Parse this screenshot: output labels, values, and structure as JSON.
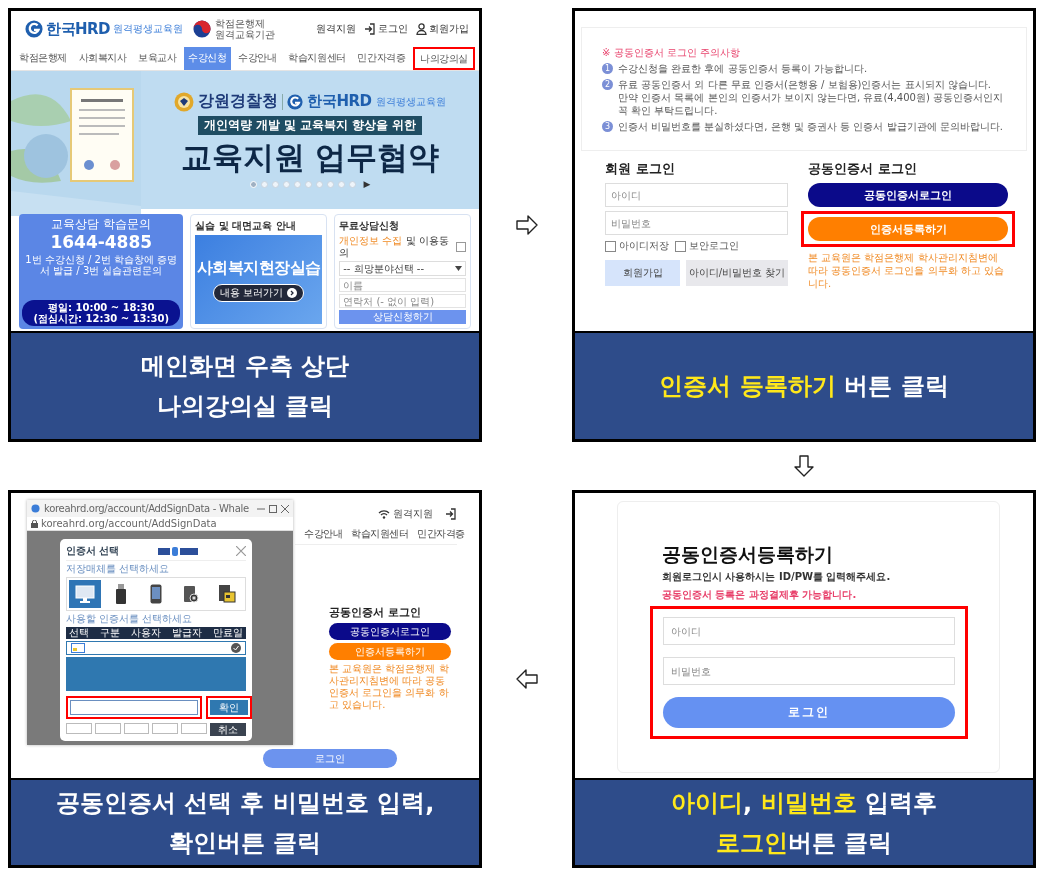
{
  "panels": [
    {
      "kind": "main_page",
      "header": {
        "logo": "한국HRD",
        "logo_sub": "원격평생교육원",
        "partner": "학점은행제 원격교육기관",
        "links": [
          {
            "kind": "remote",
            "label": "원격지원"
          },
          {
            "kind": "login",
            "label": "로그인"
          },
          {
            "kind": "join",
            "label": "회원가입"
          }
        ]
      },
      "nav": [
        {
          "label": "학점은행제",
          "selected": false,
          "highlighted": false
        },
        {
          "label": "사회복지사",
          "selected": false,
          "highlighted": false
        },
        {
          "label": "보육교사",
          "selected": false,
          "highlighted": false
        },
        {
          "label": "수강신청",
          "selected": true,
          "highlighted": false
        },
        {
          "label": "수강안내",
          "selected": false,
          "highlighted": false
        },
        {
          "label": "학습지원센터",
          "selected": false,
          "highlighted": false
        },
        {
          "label": "민간자격증",
          "selected": false,
          "highlighted": false
        },
        {
          "label": "나의강의실",
          "selected": false,
          "highlighted": true
        }
      ],
      "banner": {
        "org_left": "강원경찰청",
        "org_right": "한국HRD",
        "org_right_sub": "원격평생교육원",
        "subtitle": "개인역량 개발 및 교육복지 향상을 위한",
        "title": "교육지원 업무협약",
        "dots": [
          {
            "selected": true
          },
          {
            "selected": false
          },
          {
            "selected": false
          },
          {
            "selected": false
          },
          {
            "selected": false
          },
          {
            "selected": false
          },
          {
            "selected": false
          },
          {
            "selected": false
          },
          {
            "selected": false
          },
          {
            "selected": false
          }
        ],
        "next": "▶"
      },
      "contact": {
        "title": "교육상담 학습문의",
        "phone": "1644-4885",
        "menu": "1번 수강신청 / 2번 학습창에 증명서 발급 / 3번 실습관련문의",
        "hours": "평일: 10:00 ~ 18:30",
        "lunch": "(점심시간: 12:30 ~ 13:30)"
      },
      "practice": {
        "title": "실습 및 대면교육 안내",
        "banner": "사회복지현장실습",
        "link": "내용 보러가기"
      },
      "consult": {
        "title": "무료상담신청",
        "consent_highlight": "개인정보 수집",
        "consent": "및 이용동의",
        "consent_checked": false,
        "select": "-- 희망분야선택 --",
        "name_placeholder": "이름",
        "phone_placeholder": "연락처 (- 없이 입력)",
        "submit": "상담신청하기"
      },
      "caption": [
        [
          {
            "text": "메인화면 우측 상단",
            "highlight": false
          }
        ],
        [
          {
            "text": "나의강의실 클릭",
            "highlight": false
          }
        ]
      ]
    },
    {
      "kind": "cert_login",
      "notice": {
        "title": "※ 공동인증서 로그인 주의사항",
        "items": [
          {
            "number": "1",
            "lines": [
              "수강신청을 완료한 후에 공동인증서 등록이 가능합니다."
            ]
          },
          {
            "number": "2",
            "lines": [
              "유료 공동인증서 외 다른 무료 인증서(은행용 / 보험용)인증서는 표시되지 않습니다.",
              "만약 인증서 목록에 본인의 인증서가 보이지 않는다면, 유료(4,400원) 공동인증서인지 꼭 확인 부탁드립니다."
            ]
          },
          {
            "number": "3",
            "lines": [
              "인증서 비밀번호를 분실하셨다면, 은행 및 증권사 등 인증서 발급기관에 문의바랍니다."
            ]
          }
        ]
      },
      "member_login": {
        "title": "회원 로그인",
        "id_placeholder": "아이디",
        "pw_placeholder": "비밀번호",
        "options": [
          {
            "label": "아이디저장",
            "checked": false
          },
          {
            "label": "보안로그인",
            "checked": false
          }
        ],
        "buttons": [
          {
            "kind": "join",
            "label": "회원가입"
          },
          {
            "kind": "find",
            "label": "아이디/비밀번호 찾기"
          }
        ]
      },
      "cert_login": {
        "title": "공동인증서 로그인",
        "buttons": [
          {
            "kind": "login",
            "label": "공동인증서로그인",
            "highlighted": false
          },
          {
            "kind": "register",
            "label": "인증서등록하기",
            "highlighted": true
          }
        ],
        "note": "본 교육원은 학점은행제 학사관리지침변에 따라 공동인증서 로그인을 의무화 하고 있습니다."
      },
      "caption": [
        [
          {
            "text": "인증서 등록하기",
            "highlight": true
          },
          {
            "text": " 버튼 클릭",
            "highlight": false
          }
        ]
      ]
    },
    {
      "kind": "cert_select",
      "browser": {
        "title": "koreahrd.org/account/AddSignData - Whale",
        "address": "koreahrd.org/account/AddSignData"
      },
      "dialog": {
        "title": "인증서 선택",
        "media_label": "저장매체를 선택하세요",
        "media": [
          {
            "kind": "disk",
            "selected": true
          },
          {
            "kind": "usb",
            "selected": false
          },
          {
            "kind": "phone",
            "selected": false
          },
          {
            "kind": "token",
            "selected": false
          },
          {
            "kind": "card",
            "selected": false
          }
        ],
        "list_label": "사용할 인증서를 선택하세요",
        "columns": [
          "선택",
          "구분",
          "사용자",
          "발급자",
          "만료일"
        ],
        "password_highlighted": true,
        "confirm": {
          "label": "확인",
          "highlighted": true
        },
        "cancel": "취소"
      },
      "page": {
        "remote": "원격지원",
        "nav": [
          "수강안내",
          "학습지원센터",
          "민간자격증"
        ],
        "cert_title": "공동인증서 로그인",
        "cert_buttons": [
          {
            "kind": "login",
            "label": "공동인증서로그인"
          },
          {
            "kind": "register",
            "label": "인증서등록하기"
          }
        ],
        "note": "본 교육원은 학점은행제 학사관리지침변에 따라 공동인증서 로그인을 의무화 하고 있습니다.",
        "login": "로그인"
      },
      "caption": [
        [
          {
            "text": "공동인증서 선택 후 비밀번호 입력,",
            "highlight": false
          }
        ],
        [
          {
            "text": "확인버튼 클릭",
            "highlight": false
          }
        ]
      ]
    },
    {
      "kind": "cert_register",
      "title": "공동인증서등록하기",
      "instruction": "회원로그인시 사용하시는 ID/PW를 입력해주세요.",
      "warning": "공동인증서 등록은 과정결제후 가능합니다.",
      "form": {
        "highlighted": true,
        "id_placeholder": "아이디",
        "pw_placeholder": "비밀번호",
        "submit": "로그인"
      },
      "caption": [
        [
          {
            "text": "아이디",
            "highlight": true
          },
          {
            "text": ", ",
            "highlight": false
          },
          {
            "text": "비밀번호",
            "highlight": true
          },
          {
            "text": " 입력후",
            "highlight": false
          }
        ],
        [
          {
            "text": "로그인",
            "highlight": true
          },
          {
            "text": "버튼 클릭",
            "highlight": false
          }
        ]
      ]
    }
  ],
  "arrows": [
    {
      "kind": "right"
    },
    {
      "kind": "down"
    },
    {
      "kind": "left"
    }
  ]
}
